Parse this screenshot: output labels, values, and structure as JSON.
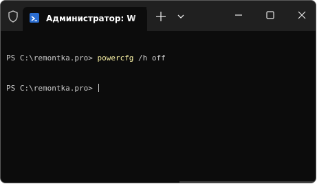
{
  "tab": {
    "title": "Администратор: W",
    "icon": "powershell-icon"
  },
  "titlebar": {
    "shield_icon": "shield-icon",
    "new_tab_icon": "plus-icon",
    "dropdown_icon": "chevron-down-icon",
    "minimize_icon": "minimize-icon",
    "maximize_icon": "maximize-icon",
    "close_icon": "close-icon"
  },
  "terminal": {
    "lines": [
      {
        "prompt": "PS C:\\remontka.pro> ",
        "command": "powercfg",
        "args": " /h off"
      },
      {
        "prompt": "PS C:\\remontka.pro> ",
        "command": "",
        "args": ""
      }
    ]
  },
  "colors": {
    "background": "#0c0c0c",
    "titlebar": "#202020",
    "text": "#cccccc",
    "command": "#f9f1a5",
    "accent": "#2a6dd2"
  }
}
